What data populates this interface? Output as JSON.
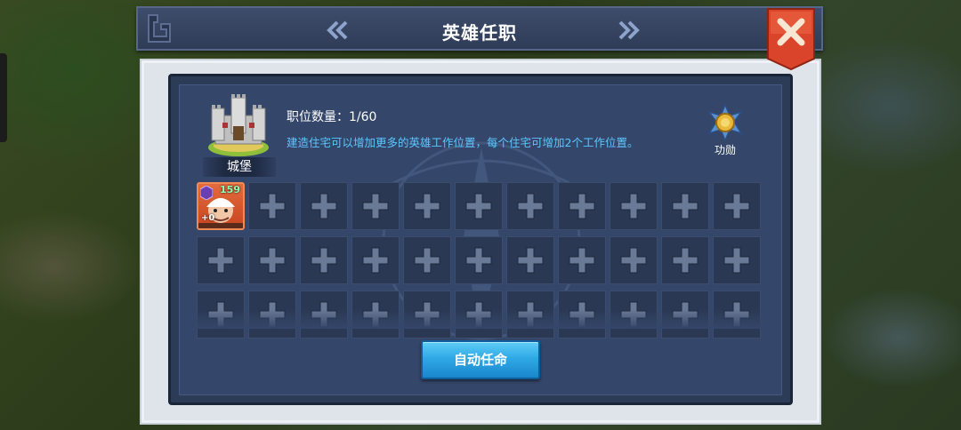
{
  "window": {
    "title": "英雄任职"
  },
  "castle": {
    "label": "城堡",
    "position_count": "职位数量：1/60",
    "hint": "建造住宅可以增加更多的英雄工作位置，每个住宅可增加2个工作位置。"
  },
  "merit": {
    "label": "功勋"
  },
  "hero": {
    "level": "159",
    "star_bonus": "+0"
  },
  "slots": {
    "filled": 1,
    "visible_count": 33
  },
  "actions": {
    "auto_assign_label": "自动任命"
  },
  "icons": {
    "close": "close-icon",
    "prev": "double-chevron-left-icon",
    "next": "double-chevron-right-icon",
    "add": "plus-icon",
    "merit": "medal-icon",
    "castle": "castle-icon"
  },
  "colors": {
    "hint_text": "#5cc7ff",
    "close_button": "#e04b2c",
    "button_blue": "#2fa9e6",
    "hero_card": "#e36b3c"
  }
}
